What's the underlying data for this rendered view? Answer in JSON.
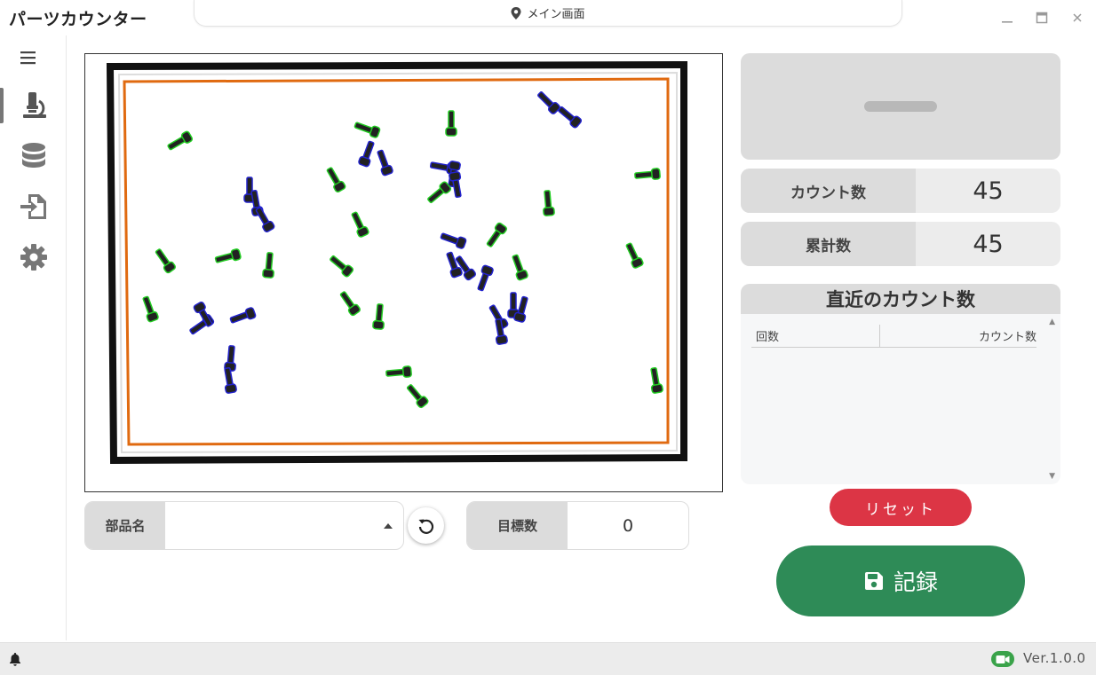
{
  "window": {
    "title": "パーツカウンター",
    "location": "メイン画面",
    "location_icon": "map-pin-icon",
    "controls": [
      "minimize-icon",
      "maximize-icon",
      "close-icon"
    ]
  },
  "sidebar": {
    "items": [
      {
        "name": "menu",
        "icon": "hamburger-icon"
      },
      {
        "name": "inspect",
        "icon": "microscope-icon",
        "active": true
      },
      {
        "name": "database",
        "icon": "database-icon"
      },
      {
        "name": "import",
        "icon": "file-import-icon"
      },
      {
        "name": "settings",
        "icon": "gear-icon"
      }
    ]
  },
  "camera": {
    "icon": "camera-view"
  },
  "part_field": {
    "label": "部品名",
    "value": "",
    "dropdown_icon": "caret-up-icon"
  },
  "target_field": {
    "label": "目標数",
    "value": "0"
  },
  "stats": {
    "count_label": "カウント数",
    "count_value": "45",
    "total_label": "累計数",
    "total_value": "45"
  },
  "recent": {
    "title": "直近のカウント数",
    "col_round": "回数",
    "col_count": "カウント数",
    "rows": []
  },
  "buttons": {
    "reset": "リセット",
    "save": "記録"
  },
  "footer": {
    "version": "Ver.1.0.0"
  },
  "colors": {
    "reset": "#dc3545",
    "save": "#2e8b57",
    "tray_inner": "#e06a10",
    "detect_green": "#22cc22",
    "detect_blue": "#2222cc",
    "camera_badge": "#3aa34a"
  }
}
